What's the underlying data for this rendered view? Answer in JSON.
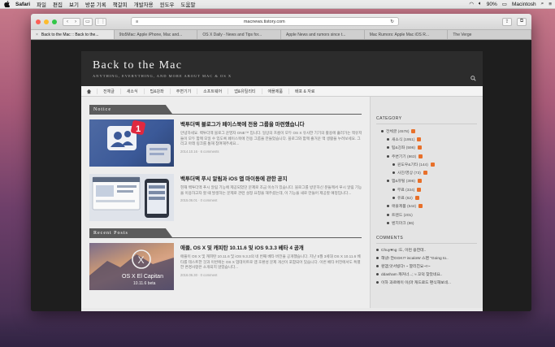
{
  "menubar": {
    "app": "Safari",
    "items": [
      "파일",
      "편집",
      "보기",
      "방문 기록",
      "책갈피",
      "개발자용",
      "윈도우",
      "도움말"
    ],
    "battery": "90%",
    "computer_name": "Macintosh"
  },
  "browser": {
    "url": "macnews.tistory.com",
    "tabs": [
      "Back to the Mac :: Back to the...",
      "9to5Mac: Apple iPhone, Mac and...",
      "OS X Daily - News and Tips for...",
      "Apple News and rumors since t...",
      "Mac Rumors: Apple Mac iOS R...",
      "The Verge"
    ]
  },
  "site": {
    "title": "Back to the Mac",
    "subtitle": "ANYTHING, EVERYTHING, AND MORE ABOUT MAC & OS X",
    "nav": [
      "전체글",
      "새소식",
      "팁&강좌",
      "주변기기",
      "소프트웨어",
      "앱&유틸리티",
      "애플제품",
      "배포 & 자료"
    ]
  },
  "notice": {
    "label": "Notice",
    "posts": [
      {
        "title": "백투더맥 블로그가 페이스북에 전용 그룹을 마련했습니다",
        "excerpt": "안녕하세요. 백투더맥 블로그 운영자 ONE™ 입니다. 일상의 흐름이 모두 OS X 유사한 기기의 활용에 흘러가는 맥유저들이 모두 함께 모일 수 있도록 페이스북에 전용 그룹을 만들었습니다. 블로그와 함께 즐거운 맥 생활을 누려보세요. 그리고 아래 링크를 통해 참여해주세요...",
        "meta": "2014.10.16 · 6 comments"
      },
      {
        "title": "백투더맥 푸시 알림과 iOS 앱 마이동에 관한 공지",
        "excerpt": "현재 백투더맥 푸시 알림 기능에 제공되었던 문제로 조금 이슈가 있습니다. 블로그를 방문하신 분들께서 푸시 알림 기능을 이용하고자 할 때 발생하는 문제로 관련 설정 요청을 해주셨는데, 이 기능을 새로 만들어 제공할 예정입니다...",
        "meta": "2015.06.01 · 0 comment"
      }
    ]
  },
  "recent": {
    "label": "Recent Posts",
    "posts": [
      {
        "title": "애플, OS X 및 캐피탄 10.11.6 및 iOS 9.3.3 베타 4 공개",
        "excerpt": "애플이 OS X 및 캐피탄 10.11.6 및 iOS 9.3.3의 네 번째 베타 버전을 공개했습니다. 지난 5월 3세대 OS X 10.11.6 베타를 테스트한 것과 이번에는 OS X 업데이트로 앱 호환성 문제 개선이 포함되어 있습니다. 이번 베타 버전에서도 특별한 변경사항은 소개되지 않았습니다...",
        "meta": "2016.06.30 · 0 comment",
        "thumb_text": "OS X El Capitan",
        "thumb_sub": "10.11.6 beta"
      }
    ]
  },
  "sidebar": {
    "category_heading": "CATEGORY",
    "categories": [
      {
        "label": "전체글 (4578)",
        "level": 1
      },
      {
        "label": "새소식 (1951)",
        "level": 2
      },
      {
        "label": "팁&강좌 (596)",
        "level": 2
      },
      {
        "label": "주변기기 (863)",
        "level": 2
      },
      {
        "label": "윈도우&기타 (144)",
        "level": 3
      },
      {
        "label": "사진/영상 (73)",
        "level": 3
      },
      {
        "label": "앱&유틸 (396)",
        "level": 2
      },
      {
        "label": "무료 (334)",
        "level": 3
      },
      {
        "label": "유료 (62)",
        "level": 3
      },
      {
        "label": "애플제품 (544)",
        "level": 2
      },
      {
        "label": "트렌드 (201)",
        "level": 2
      },
      {
        "label": "벤치마크 (86)",
        "level": 2
      }
    ],
    "comments_heading": "COMMENTS",
    "comments": [
      "Chuy♥ng :드, 이런 용한데..",
      "해냈! 얀GGK!? iscaloW 스펜 \"Going to..",
      "흰앰;앗서빙다! ~ 깔리친요~!!~",
      "ddasham 캐커너...; ≈ 꼬덕 찾았네요..",
      "이하 과르에이 이(마 캐드로드 편식해보네..."
    ]
  }
}
